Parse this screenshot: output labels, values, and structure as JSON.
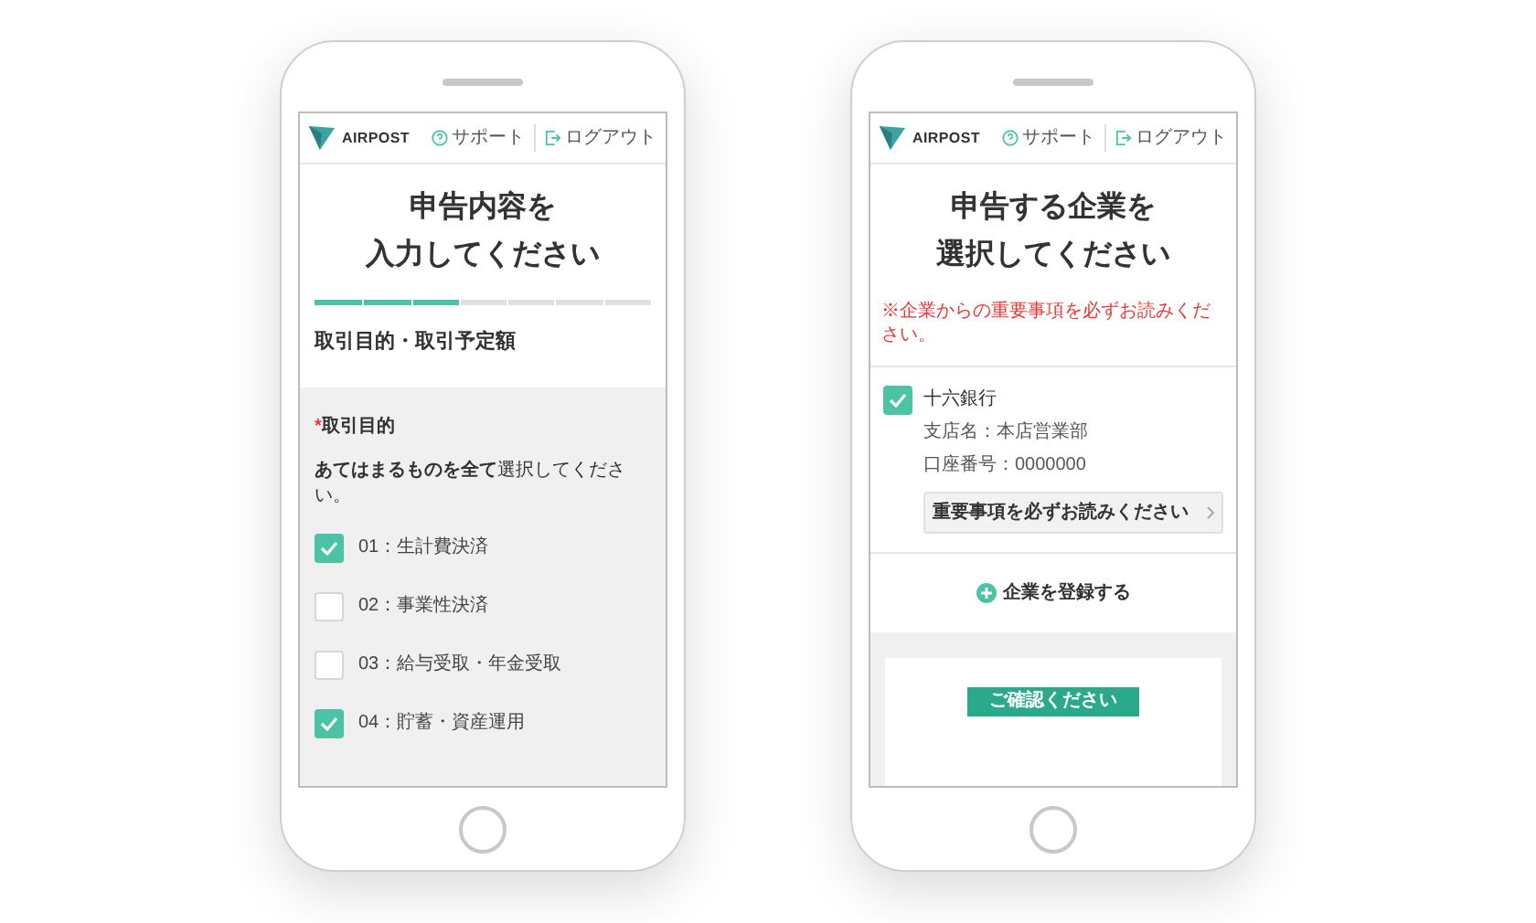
{
  "phones": [
    {
      "kind": "form",
      "header": {
        "logo": "AIRPOST",
        "support": "サポート",
        "logout": "ログアウト"
      },
      "title": [
        "申告内容を",
        "入力してください"
      ],
      "progress": {
        "level": 0.43
      },
      "section_heading": "取引目的・取引予定額",
      "field": {
        "required_mark": "*",
        "label": "取引目的",
        "instruction": "**あてはまるものを全て**選択してください。",
        "options": [
          {
            "label": "01：生計費決済",
            "checked": true
          },
          {
            "label": "02：事業性決済",
            "checked": false
          },
          {
            "label": "03：給与受取・年金受取",
            "checked": false
          },
          {
            "label": "04：貯蓄・資産運用",
            "checked": true
          }
        ]
      }
    },
    {
      "kind": "companies",
      "header": {
        "logo": "AIRPOST",
        "support": "サポート",
        "logout": "ログアウト"
      },
      "title": [
        "申告する企業を",
        "選択してください"
      ],
      "notice": "※企業からの重要事項を必ずお読みください。",
      "companies": [
        {
          "name": "十六銀行",
          "checked": true,
          "details": [
            "支店名：本店営業部",
            "口座番号：0000000"
          ],
          "link": "重要事項を必ずお読みください"
        }
      ],
      "add_button": "企業を登録する",
      "callout": "ご確認ください"
    }
  ]
}
